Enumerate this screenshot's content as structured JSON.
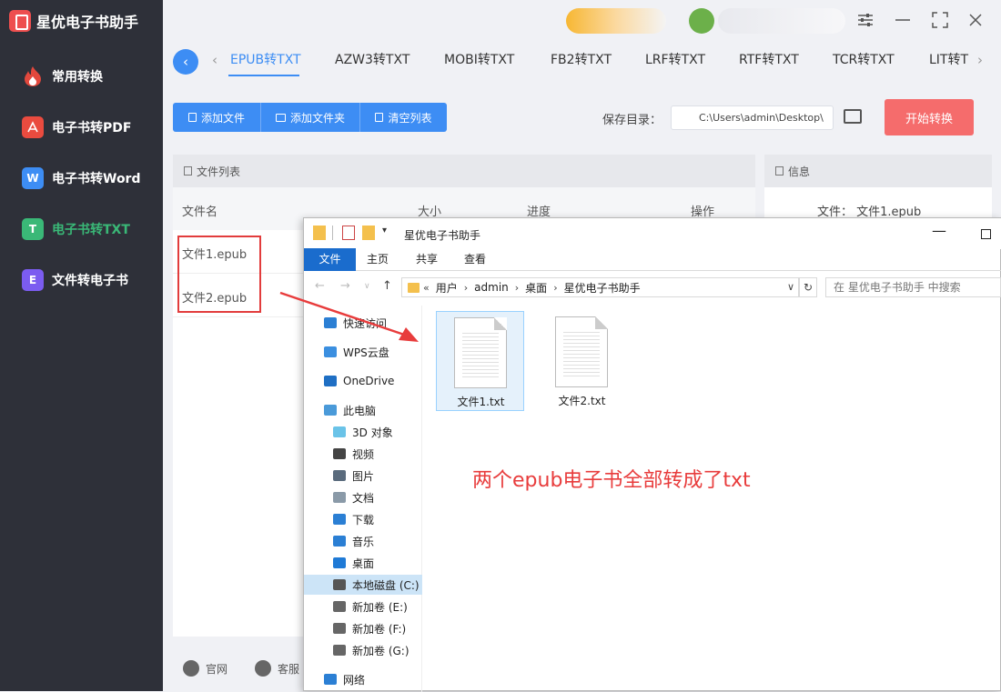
{
  "app": {
    "title": "星优电子书助手"
  },
  "sidebar": {
    "items": [
      {
        "label": "常用转换",
        "icon": "flame-icon",
        "color": "#e2483d"
      },
      {
        "label": "电子书转PDF",
        "icon": "pdf-icon",
        "color": "#ea4b3f"
      },
      {
        "label": "电子书转Word",
        "icon": "word-icon",
        "color": "#3d8df4",
        "glyph": "W"
      },
      {
        "label": "电子书转TXT",
        "icon": "txt-icon",
        "color": "#3ab877",
        "glyph": "T"
      },
      {
        "label": "文件转电子书",
        "icon": "ebook-icon",
        "color": "#7b5cf0",
        "glyph": "E"
      }
    ],
    "active_index": 3
  },
  "tabs": {
    "items": [
      "EPUB转TXT",
      "AZW3转TXT",
      "MOBI转TXT",
      "FB2转TXT",
      "LRF转TXT",
      "RTF转TXT",
      "TCR转TXT",
      "LIT转T"
    ],
    "active_index": 0
  },
  "toolbar": {
    "add_file": "添加文件",
    "add_folder": "添加文件夹",
    "clear_list": "清空列表",
    "save_label": "保存目录：",
    "save_path": "C:\\Users\\admin\\Desktop\\",
    "start_label": "开始转换"
  },
  "file_panel": {
    "title": "文件列表",
    "columns": [
      "文件名",
      "大小",
      "进度",
      "操作"
    ],
    "rows": [
      "文件1.epub",
      "文件2.epub"
    ]
  },
  "info_panel": {
    "title": "信息",
    "file_label": "文件：",
    "file_value": "文件1.epub"
  },
  "footer": {
    "website": "官网",
    "support": "客服"
  },
  "explorer": {
    "title": "星优电子书助手",
    "ribbon_tabs": [
      "文件",
      "主页",
      "共享",
      "查看"
    ],
    "breadcrumb": [
      "用户",
      "admin",
      "桌面",
      "星优电子书助手"
    ],
    "breadcrumb_prefix": "«",
    "search_placeholder": "在 星优电子书助手 中搜索",
    "nav_tree": [
      {
        "label": "快速访问",
        "icon": "star-icon",
        "color": "#2b7fd4"
      },
      {
        "label": "WPS云盘",
        "icon": "cloud-icon",
        "color": "#3b8fe0"
      },
      {
        "label": "OneDrive",
        "icon": "onedrive-icon",
        "color": "#1f6fc4"
      },
      {
        "label": "此电脑",
        "icon": "computer-icon",
        "color": "#4a9ad9"
      },
      {
        "label": "3D 对象",
        "icon": "cube-icon",
        "color": "#6ac3e8"
      },
      {
        "label": "视频",
        "icon": "video-icon",
        "color": "#444444"
      },
      {
        "label": "图片",
        "icon": "image-icon",
        "color": "#5a6b7d"
      },
      {
        "label": "文档",
        "icon": "document-icon",
        "color": "#8a9aa8"
      },
      {
        "label": "下载",
        "icon": "download-icon",
        "color": "#2b7fd4"
      },
      {
        "label": "音乐",
        "icon": "music-icon",
        "color": "#2b7fd4"
      },
      {
        "label": "桌面",
        "icon": "desktop-icon",
        "color": "#1f7ad6"
      },
      {
        "label": "本地磁盘 (C:)",
        "icon": "drive-icon",
        "color": "#555555"
      },
      {
        "label": "新加卷 (E:)",
        "icon": "drive-icon",
        "color": "#666666"
      },
      {
        "label": "新加卷 (F:)",
        "icon": "drive-icon",
        "color": "#666666"
      },
      {
        "label": "新加卷 (G:)",
        "icon": "drive-icon",
        "color": "#666666"
      },
      {
        "label": "网络",
        "icon": "network-icon",
        "color": "#2b7fd4"
      }
    ],
    "files": [
      "文件1.txt",
      "文件2.txt"
    ]
  },
  "annotation": {
    "text": "两个epub电子书全部转成了txt",
    "color": "#e83c3c"
  }
}
